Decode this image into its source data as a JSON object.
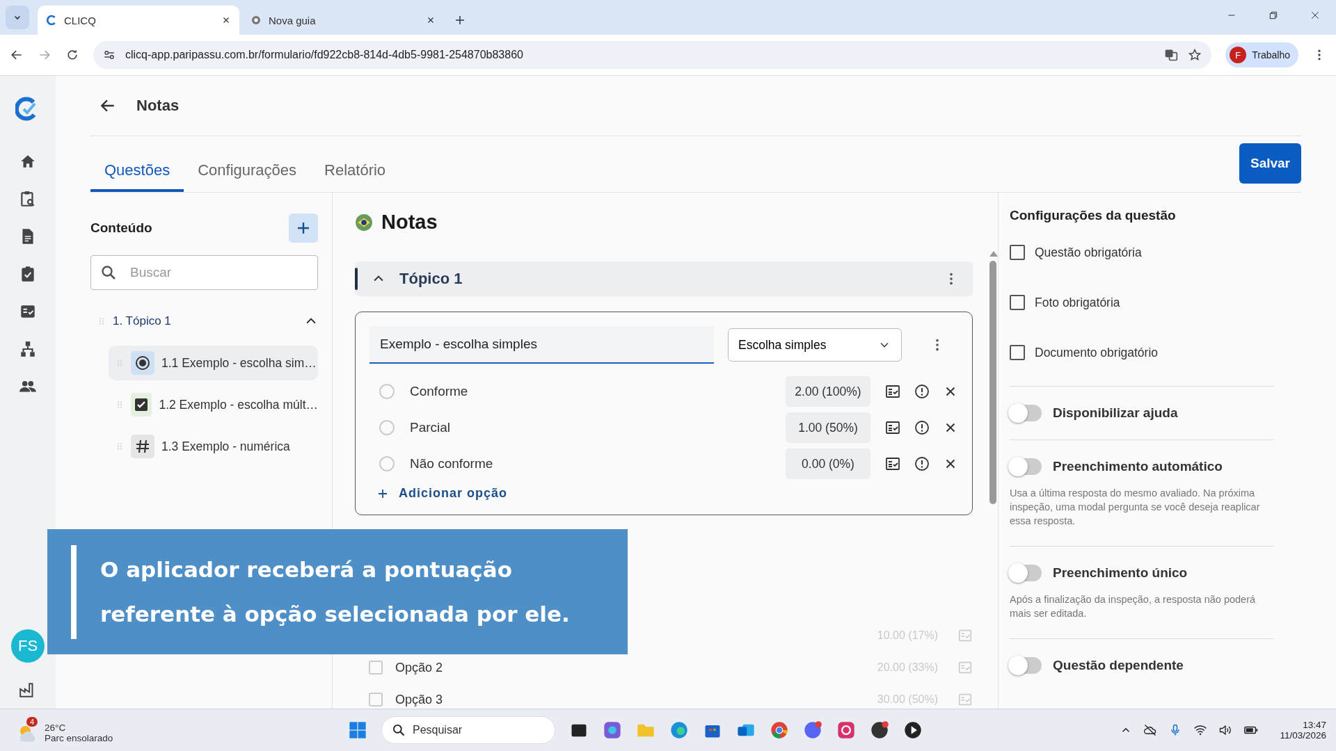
{
  "browser": {
    "tabs": [
      {
        "title": "CLICQ",
        "selected": true
      },
      {
        "title": "Nova guia",
        "selected": false
      }
    ],
    "url": "clicq-app.paripassu.com.br/formulario/fd922cb8-814d-4db5-9981-254870b83860",
    "profile": {
      "initial": "F",
      "label": "Trabalho"
    }
  },
  "rail": {
    "avatar": "FS"
  },
  "page": {
    "title": "Notas",
    "tabs": [
      {
        "label": "Questões",
        "selected": true
      },
      {
        "label": "Configurações",
        "selected": false
      },
      {
        "label": "Relatório",
        "selected": false
      }
    ],
    "save": "Salvar"
  },
  "content_panel": {
    "heading": "Conteúdo",
    "search": {
      "placeholder": "Buscar"
    },
    "tree": [
      {
        "label": "1. Tópico 1",
        "expanded": true,
        "children": [
          {
            "label": "1.1 Exemplo - escolha sim…",
            "kind": "single",
            "selected": true
          },
          {
            "label": "1.2 Exemplo - escolha múlt…",
            "kind": "multiple",
            "selected": false
          },
          {
            "label": "1.3 Exemplo - numérica",
            "kind": "numeric",
            "selected": false
          }
        ]
      }
    ]
  },
  "form": {
    "title": "Notas",
    "topic": {
      "title": "Tópico 1",
      "expanded": true
    },
    "question": {
      "title": "Exemplo - escolha simples",
      "type": "Escolha simples",
      "kind": "single",
      "options": [
        {
          "label": "Conforme",
          "score": "2.00 (100%)",
          "selected": false
        },
        {
          "label": "Parcial",
          "score": "1.00 (50%)",
          "selected": false
        },
        {
          "label": "Não conforme",
          "score": "0.00 (0%)",
          "selected": false
        }
      ],
      "add": "Adicionar opção"
    },
    "next_question": {
      "kind": "multiple",
      "options": [
        {
          "score": "10.00 (17%)"
        },
        {
          "label": "Opção 2",
          "score": "20.00 (33%)",
          "checked": false
        },
        {
          "label": "Opção 3",
          "score": "30.00 (50%)",
          "checked": false
        }
      ]
    }
  },
  "settings": {
    "heading": "Configurações da questão",
    "checks": [
      {
        "label": "Questão obrigatória",
        "checked": false
      },
      {
        "label": "Foto obrigatória",
        "checked": false
      },
      {
        "label": "Documento obrigatório",
        "checked": false
      }
    ],
    "toggles": [
      {
        "label": "Disponibilizar ajuda",
        "on": false
      },
      {
        "label": "Preenchimento automático",
        "on": false,
        "description": "Usa a última resposta do mesmo avaliado. Na próxima inspeção, uma modal pergunta se você deseja reaplicar essa resposta."
      },
      {
        "label": "Preenchimento único",
        "on": false,
        "description": "Após a finalização da inspeção, a resposta não poderá mais ser editada."
      },
      {
        "label": "Questão dependente",
        "on": false
      }
    ]
  },
  "caption": {
    "lines": [
      "O aplicador receberá a pontuação",
      "referente à opção selecionada por ele."
    ]
  },
  "taskbar": {
    "weather": {
      "badge": "4",
      "temp": "26°C",
      "desc": "Parc ensolarado"
    },
    "search": {
      "placeholder": "Pesquisar"
    },
    "time": "13:47",
    "date": "11/03/2026"
  }
}
